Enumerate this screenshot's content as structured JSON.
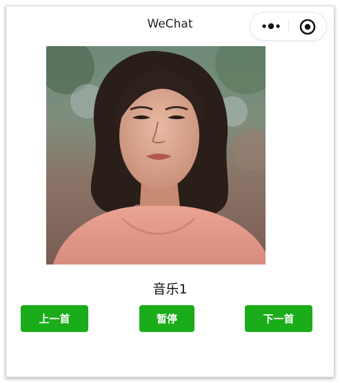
{
  "nav": {
    "title": "WeChat",
    "more_icon": "more-dots-icon",
    "close_icon": "target-circle-icon"
  },
  "player": {
    "song_title": "音乐1",
    "cover_icon": "album-cover-portrait"
  },
  "controls": {
    "prev_label": "上一首",
    "pause_label": "暂停",
    "next_label": "下一首"
  },
  "colors": {
    "accent_green": "#1aad19",
    "title_text": "#222222",
    "background": "#ffffff"
  }
}
